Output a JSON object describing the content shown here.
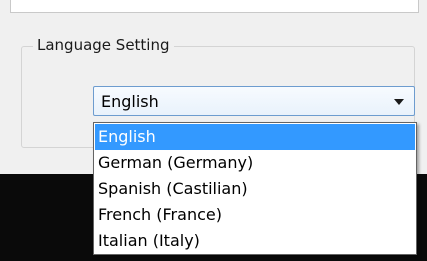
{
  "group": {
    "title": "Language Setting"
  },
  "combo": {
    "value": "English",
    "arrow_icon": "chevron-down-icon"
  },
  "dropdown": {
    "options": [
      {
        "label": "English",
        "selected": true
      },
      {
        "label": "German (Germany)",
        "selected": false
      },
      {
        "label": "Spanish (Castilian)",
        "selected": false
      },
      {
        "label": "French (France)",
        "selected": false
      },
      {
        "label": "Italian (Italy)",
        "selected": false
      }
    ]
  },
  "colors": {
    "selection": "#3399ff",
    "background": "#f0f0f0",
    "combo_border": "#6d9ccf"
  }
}
